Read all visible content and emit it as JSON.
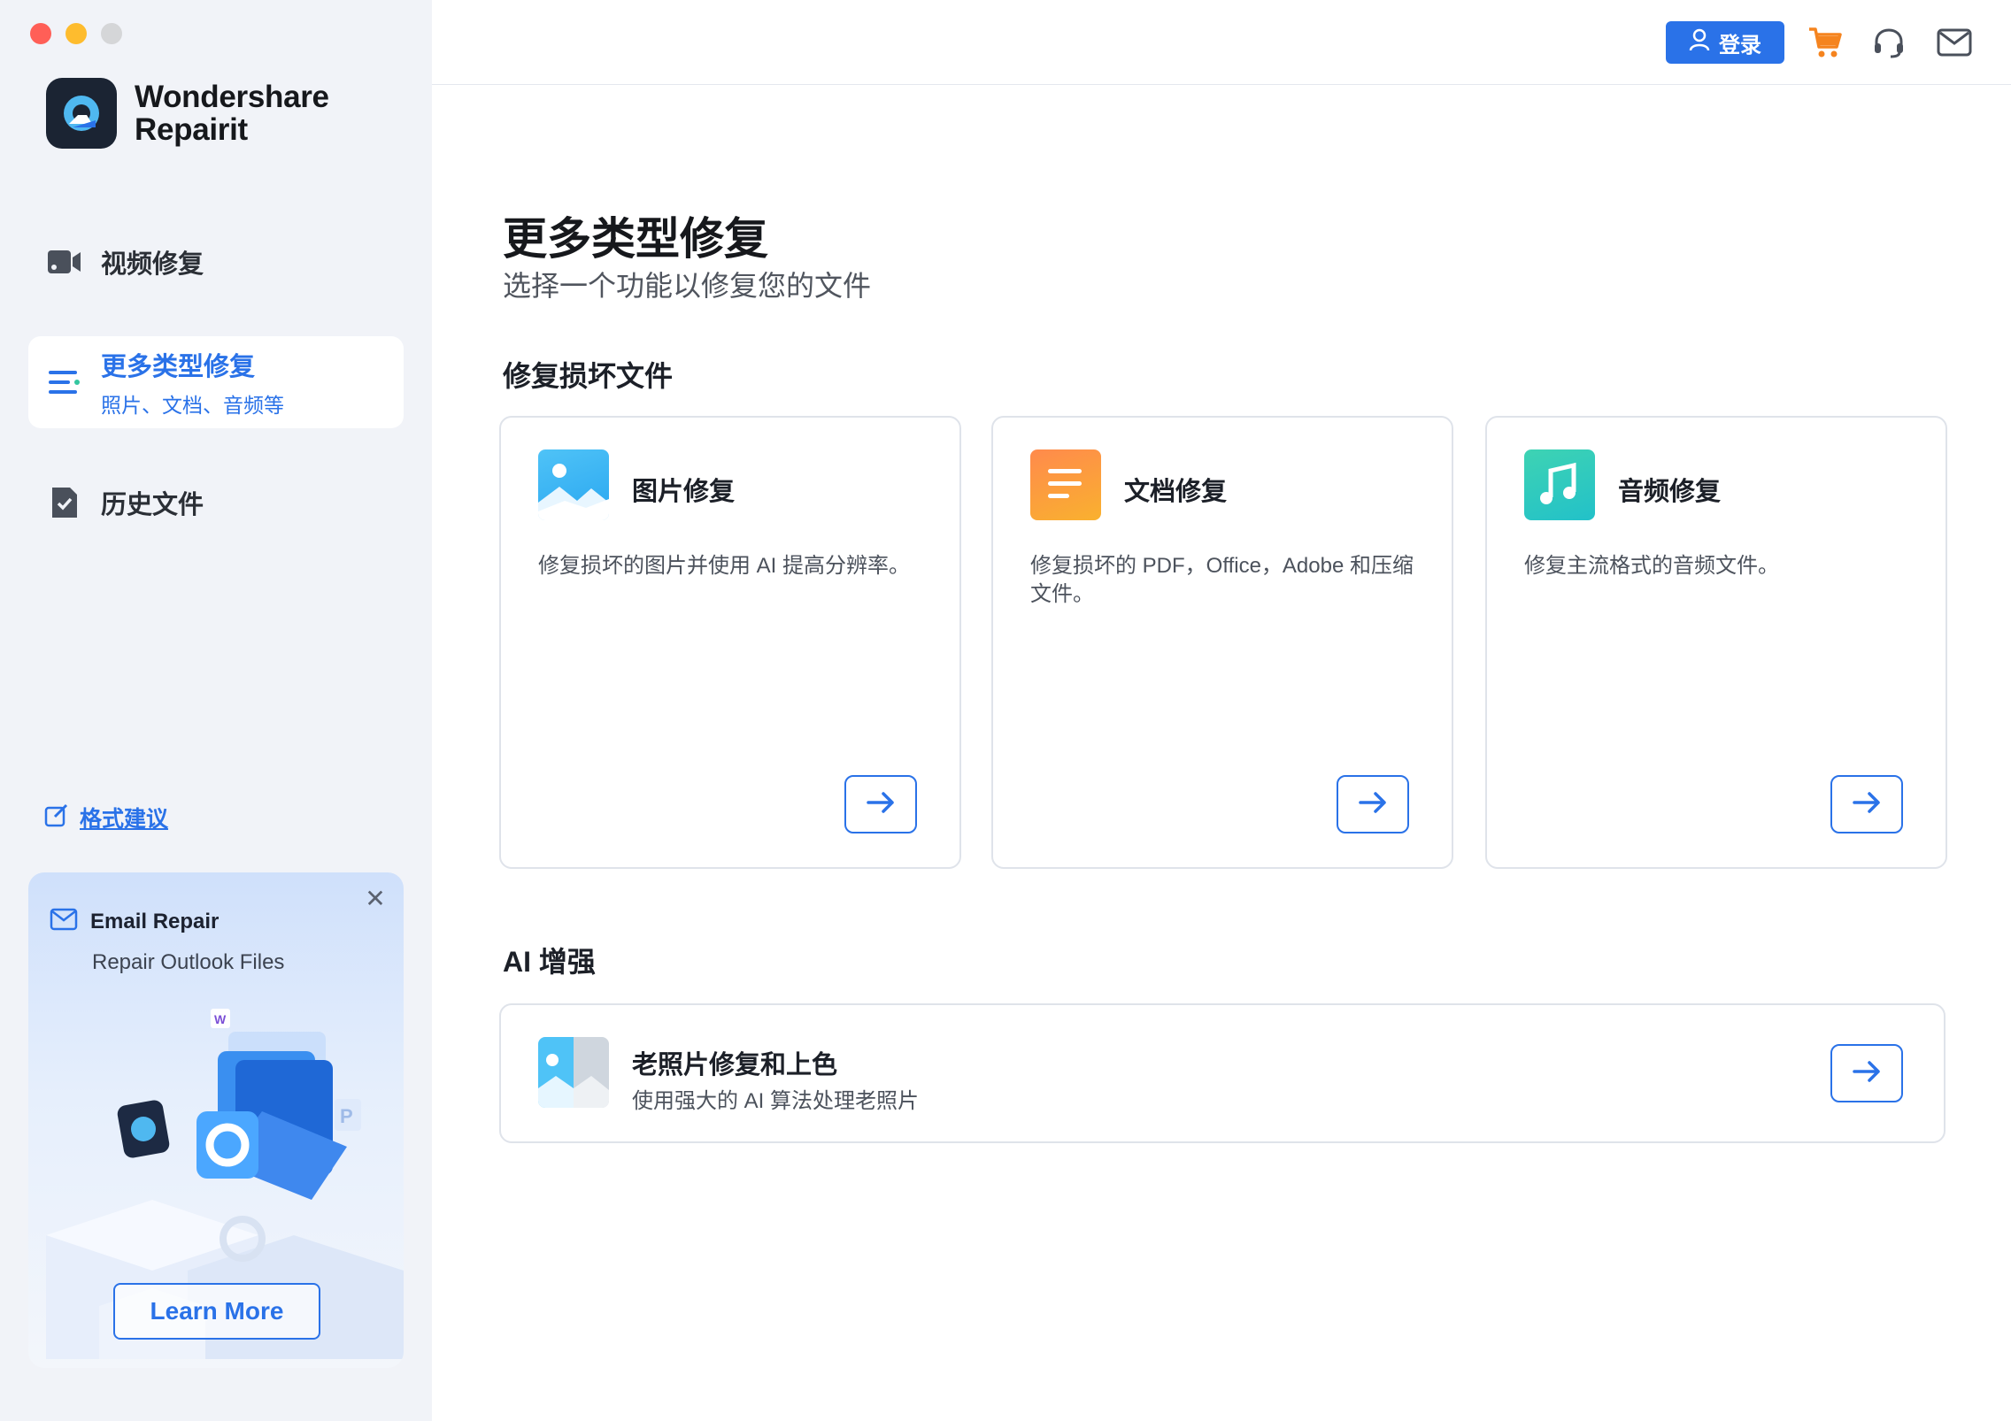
{
  "app": {
    "brand_line1": "Wondershare",
    "brand_line2": "Repairit"
  },
  "sidebar": {
    "items": [
      {
        "label": "视频修复",
        "icon": "video-camera-icon"
      },
      {
        "label": "更多类型修复",
        "sub": "照片、文档、音频等",
        "icon": "menu-lines-icon",
        "active": true
      },
      {
        "label": "历史文件",
        "icon": "file-check-icon"
      }
    ],
    "format_link": "格式建议"
  },
  "promo": {
    "title": "Email Repair",
    "subtitle": "Repair Outlook Files",
    "button": "Learn More"
  },
  "topbar": {
    "login_label": "登录",
    "icons": [
      "cart-icon",
      "headset-icon",
      "mail-icon"
    ]
  },
  "main": {
    "title": "更多类型修复",
    "subtitle": "选择一个功能以修复您的文件",
    "section_repair": "修复损坏文件",
    "cards": [
      {
        "title": "图片修复",
        "desc": "修复损坏的图片并使用 AI 提高分辨率。",
        "icon": "image-icon"
      },
      {
        "title": "文档修复",
        "desc": "修复损坏的 PDF，Office，Adobe 和压缩文件。",
        "icon": "document-icon"
      },
      {
        "title": "音频修复",
        "desc": "修复主流格式的音频文件。",
        "icon": "music-icon"
      }
    ],
    "section_ai": "AI 增强",
    "ai_card": {
      "title": "老照片修复和上色",
      "desc": "使用强大的 AI 算法处理老照片"
    }
  },
  "colors": {
    "accent": "#2a72e8",
    "sidebar_bg": "#f1f3f8",
    "cart": "#f5841f"
  }
}
